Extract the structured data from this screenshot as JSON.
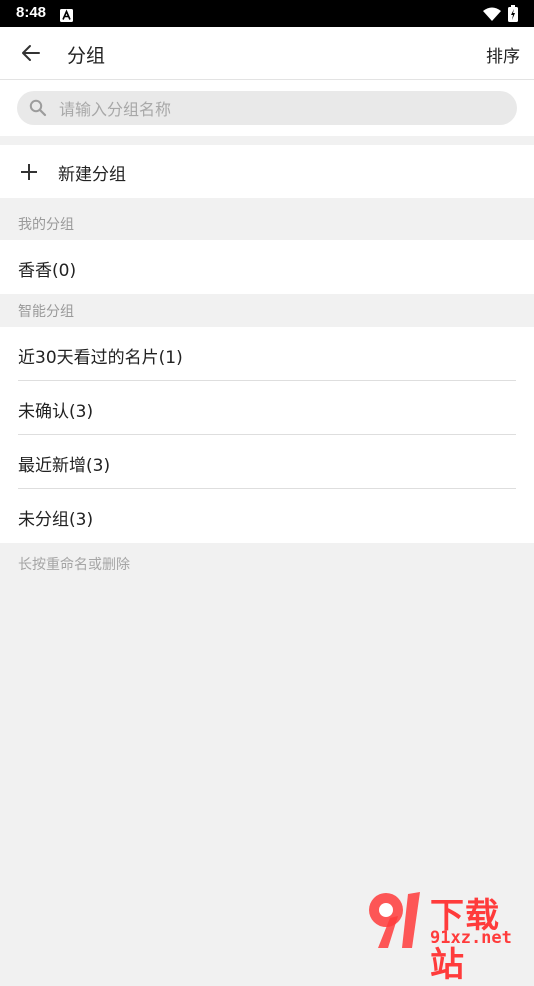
{
  "status_bar": {
    "time": "8:48",
    "icons": [
      "notification-a-icon",
      "wifi-icon",
      "battery-charging-icon"
    ]
  },
  "app_bar": {
    "back_icon": "arrow-left-icon",
    "title": "分组",
    "sort_label": "排序"
  },
  "search": {
    "icon": "search-icon",
    "placeholder": "请输入分组名称",
    "value": ""
  },
  "new_group": {
    "icon": "plus-icon",
    "label": "新建分组"
  },
  "my_groups": {
    "header": "我的分组",
    "items": [
      {
        "label": "香香(0)"
      }
    ]
  },
  "smart_groups": {
    "header": "智能分组",
    "items": [
      {
        "label": "近30天看过的名片(1)"
      },
      {
        "label": "未确认(3)"
      },
      {
        "label": "最近新增(3)"
      },
      {
        "label": "未分组(3)"
      }
    ]
  },
  "hint": "长按重命名或删除",
  "watermark": {
    "brand_cn": "下载站",
    "brand_url": "91xz.net",
    "logo_color": "#ff3b3b"
  },
  "colors": {
    "background": "#f1f1f1",
    "surface": "#ffffff",
    "search_fill": "#e9e9e9",
    "secondary_text": "#9a9a9a"
  }
}
